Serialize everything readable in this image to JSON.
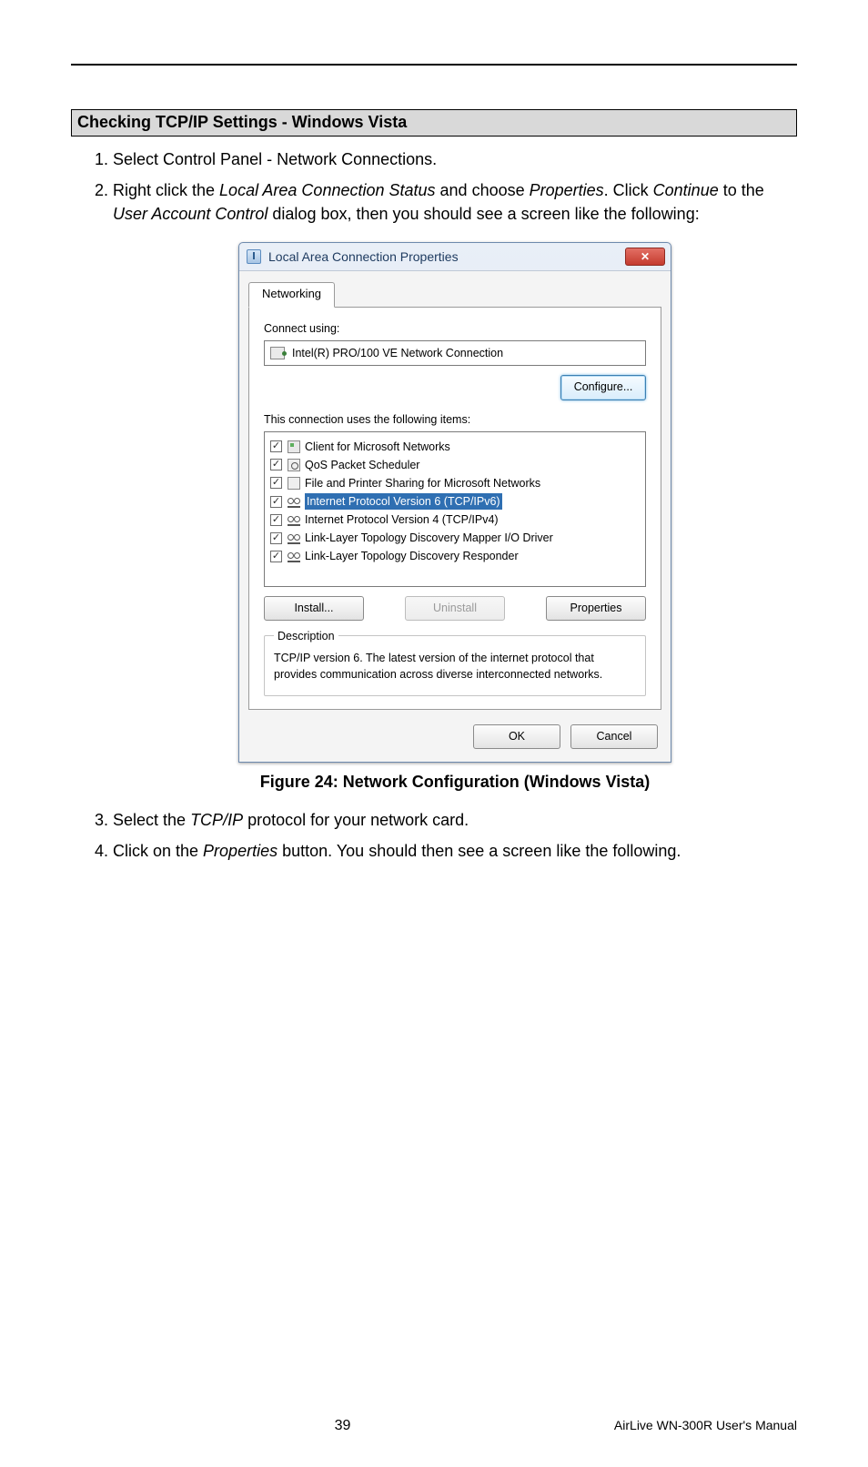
{
  "heading": "Checking TCP/IP Settings - Windows Vista",
  "steps": {
    "s1": "Select Control Panel - Network Connections.",
    "s2a": "Right click the ",
    "s2b": "Local Area Connection Status",
    "s2c": " and choose ",
    "s2d": "Properties",
    "s2e": ". Click ",
    "s2f": "Continue",
    "s2g": " to the ",
    "s2h": "User Account Control",
    "s2i": " dialog box, then you should see a screen like the following:",
    "s3a": "Select the ",
    "s3b": "TCP/IP",
    "s3c": " protocol for your network card.",
    "s4a": "Click on the ",
    "s4b": "Properties",
    "s4c": " button. You should then see a screen like the following."
  },
  "win": {
    "title": "Local Area Connection Properties",
    "tab": "Networking",
    "connect_using": "Connect using:",
    "adapter": "Intel(R) PRO/100 VE Network Connection",
    "configure": "Configure...",
    "uses_label": "This connection uses the following items:",
    "items": {
      "i0": "Client for Microsoft Networks",
      "i1": "QoS Packet Scheduler",
      "i2": "File and Printer Sharing for Microsoft Networks",
      "i3": "Internet Protocol Version 6 (TCP/IPv6)",
      "i4": "Internet Protocol Version 4 (TCP/IPv4)",
      "i5": "Link-Layer Topology Discovery Mapper I/O Driver",
      "i6": "Link-Layer Topology Discovery Responder"
    },
    "install": "Install...",
    "uninstall": "Uninstall",
    "properties": "Properties",
    "desc_legend": "Description",
    "desc_text": "TCP/IP version 6. The latest version of the internet protocol that provides communication across diverse interconnected networks.",
    "ok": "OK",
    "cancel": "Cancel",
    "close": "✕"
  },
  "figure_caption": "Figure 24: Network Configuration (Windows Vista)",
  "footer": {
    "page": "39",
    "manual": "AirLive WN-300R User's Manual"
  }
}
